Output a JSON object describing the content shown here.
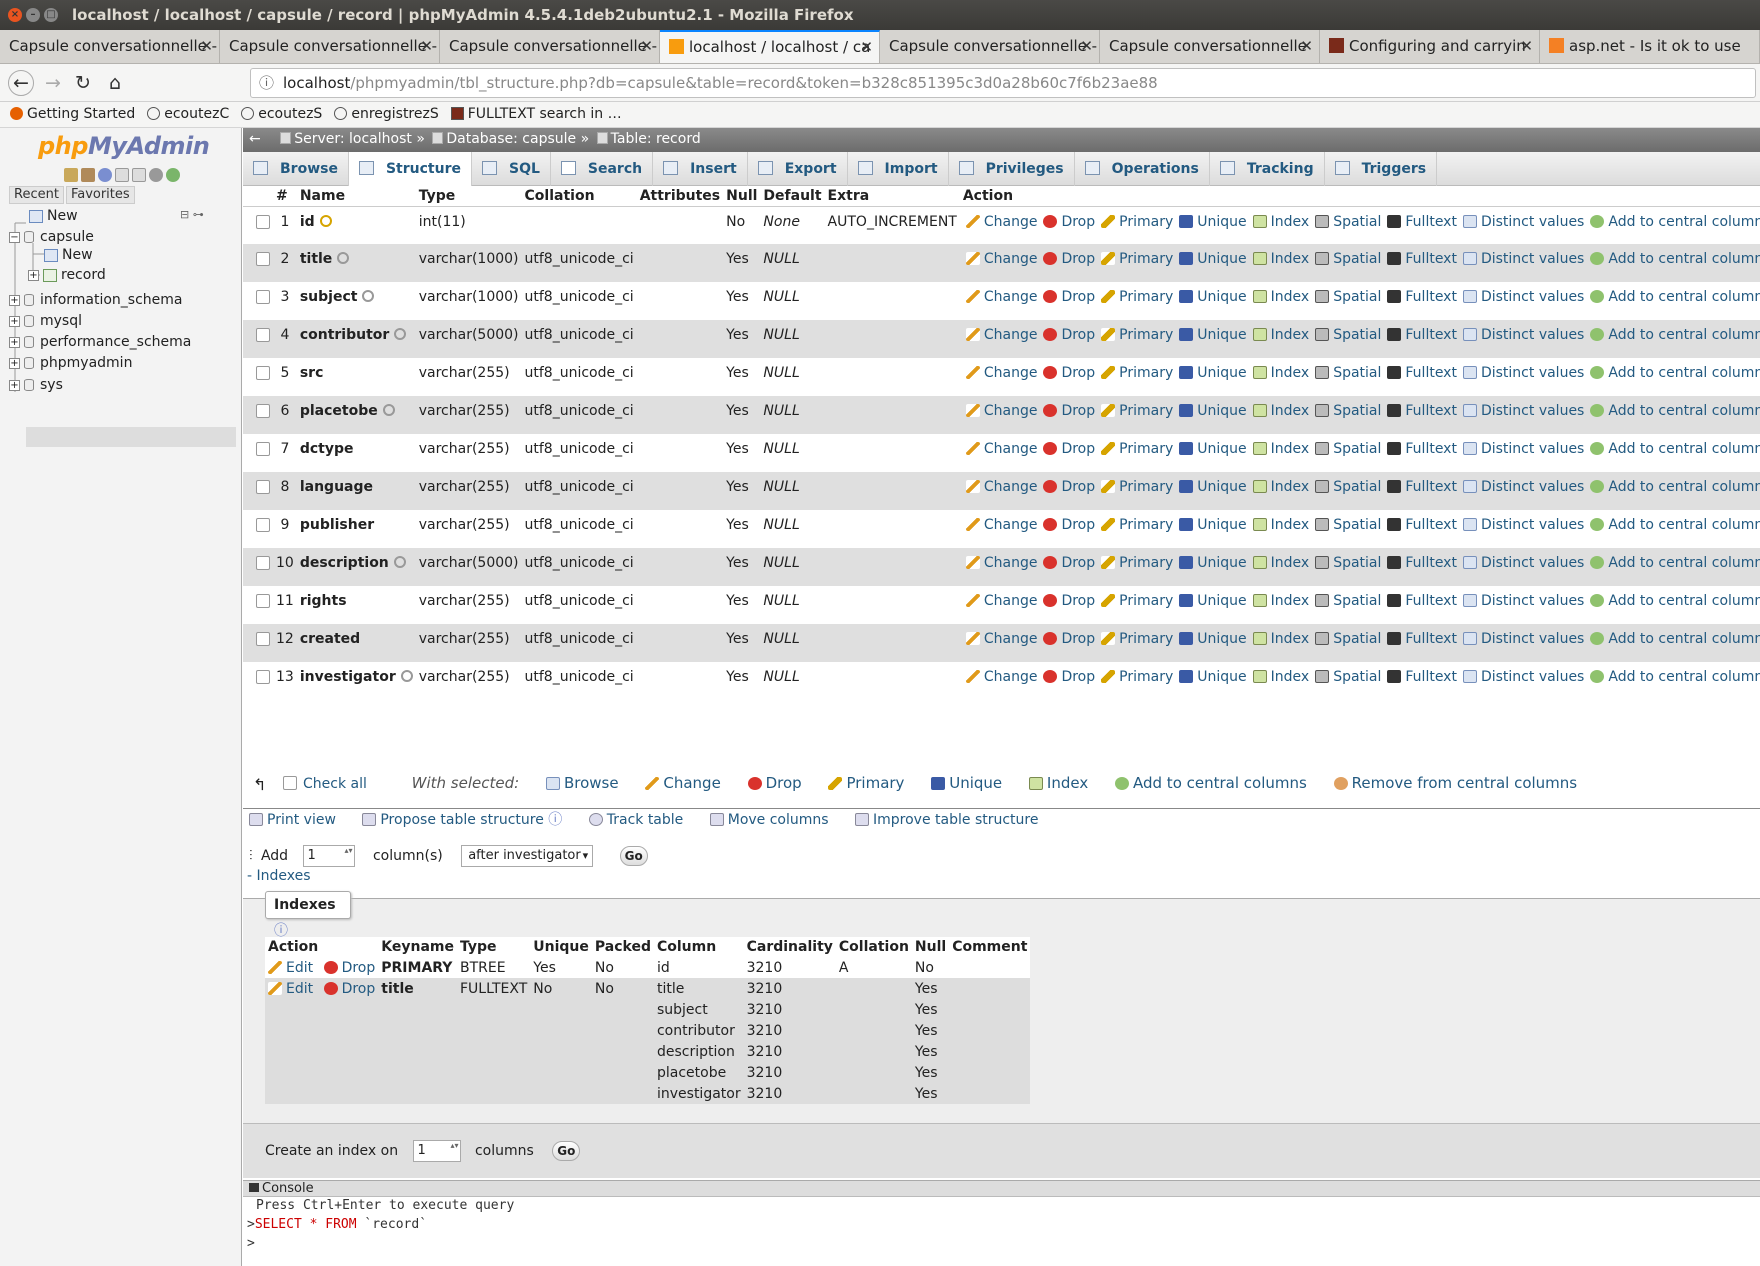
{
  "window": {
    "title": "localhost / localhost / capsule / record | phpMyAdmin 4.5.4.1deb2ubuntu2.1 - Mozilla Firefox"
  },
  "browser_tabs": [
    {
      "label": "Capsule conversationnelle -"
    },
    {
      "label": "Capsule conversationnelle -"
    },
    {
      "label": "Capsule conversationnelle -"
    },
    {
      "label": "localhost / localhost / ca"
    },
    {
      "label": "Capsule conversationnelle -"
    },
    {
      "label": "Capsule conversationnelle"
    },
    {
      "label": "Configuring and carryin"
    },
    {
      "label": "asp.net - Is it ok to use"
    }
  ],
  "url": {
    "host": "localhost",
    "path": "/phpmyadmin/tbl_structure.php?db=capsule&table=record&token=b328c851395c3d0a28b60c7f6b23ae88"
  },
  "bookmarks": [
    "Getting Started",
    "ecoutezC",
    "ecoutezS",
    "enregistrezS",
    "FULLTEXT search in …"
  ],
  "sidebar": {
    "logo_a": "php",
    "logo_b": "MyAdmin",
    "recent": "Recent",
    "favorites": "Favorites",
    "tree": {
      "new": "New",
      "capsule": "capsule",
      "capsule_new": "New",
      "record": "record",
      "information_schema": "information_schema",
      "mysql": "mysql",
      "performance_schema": "performance_schema",
      "phpmyadmin": "phpmyadmin",
      "sys": "sys"
    }
  },
  "breadcrumb": {
    "server": "Server: localhost",
    "database": "Database: capsule",
    "table": "Table: record"
  },
  "tabs": [
    "Browse",
    "Structure",
    "SQL",
    "Search",
    "Insert",
    "Export",
    "Import",
    "Privileges",
    "Operations",
    "Tracking",
    "Triggers"
  ],
  "structure": {
    "headers": [
      "#",
      "Name",
      "Type",
      "Collation",
      "Attributes",
      "Null",
      "Default",
      "Extra",
      "Action"
    ],
    "rows": [
      {
        "n": "1",
        "name": "id",
        "type": "int(11)",
        "collation": "",
        "null": "No",
        "default": "None",
        "extra": "AUTO_INCREMENT"
      },
      {
        "n": "2",
        "name": "title",
        "type": "varchar(1000)",
        "collation": "utf8_unicode_ci",
        "null": "Yes",
        "default": "NULL",
        "extra": ""
      },
      {
        "n": "3",
        "name": "subject",
        "type": "varchar(1000)",
        "collation": "utf8_unicode_ci",
        "null": "Yes",
        "default": "NULL",
        "extra": ""
      },
      {
        "n": "4",
        "name": "contributor",
        "type": "varchar(5000)",
        "collation": "utf8_unicode_ci",
        "null": "Yes",
        "default": "NULL",
        "extra": ""
      },
      {
        "n": "5",
        "name": "src",
        "type": "varchar(255)",
        "collation": "utf8_unicode_ci",
        "null": "Yes",
        "default": "NULL",
        "extra": ""
      },
      {
        "n": "6",
        "name": "placetobe",
        "type": "varchar(255)",
        "collation": "utf8_unicode_ci",
        "null": "Yes",
        "default": "NULL",
        "extra": ""
      },
      {
        "n": "7",
        "name": "dctype",
        "type": "varchar(255)",
        "collation": "utf8_unicode_ci",
        "null": "Yes",
        "default": "NULL",
        "extra": ""
      },
      {
        "n": "8",
        "name": "language",
        "type": "varchar(255)",
        "collation": "utf8_unicode_ci",
        "null": "Yes",
        "default": "NULL",
        "extra": ""
      },
      {
        "n": "9",
        "name": "publisher",
        "type": "varchar(255)",
        "collation": "utf8_unicode_ci",
        "null": "Yes",
        "default": "NULL",
        "extra": ""
      },
      {
        "n": "10",
        "name": "description",
        "type": "varchar(5000)",
        "collation": "utf8_unicode_ci",
        "null": "Yes",
        "default": "NULL",
        "extra": ""
      },
      {
        "n": "11",
        "name": "rights",
        "type": "varchar(255)",
        "collation": "utf8_unicode_ci",
        "null": "Yes",
        "default": "NULL",
        "extra": ""
      },
      {
        "n": "12",
        "name": "created",
        "type": "varchar(255)",
        "collation": "utf8_unicode_ci",
        "null": "Yes",
        "default": "NULL",
        "extra": ""
      },
      {
        "n": "13",
        "name": "investigator",
        "type": "varchar(255)",
        "collation": "utf8_unicode_ci",
        "null": "Yes",
        "default": "NULL",
        "extra": ""
      }
    ],
    "actions": {
      "change": "Change",
      "drop": "Drop",
      "primary": "Primary",
      "unique": "Unique",
      "index": "Index",
      "spatial": "Spatial",
      "fulltext": "Fulltext",
      "distinct": "Distinct values",
      "central": "Add to central columns"
    }
  },
  "bulk": {
    "check_all": "Check all",
    "with_selected": "With selected:",
    "browse": "Browse",
    "change": "Change",
    "drop": "Drop",
    "primary": "Primary",
    "unique": "Unique",
    "index": "Index",
    "add_central": "Add to central columns",
    "remove_central": "Remove from central columns"
  },
  "tools": {
    "print": "Print view",
    "propose": "Propose table structure",
    "track": "Track table",
    "move": "Move columns",
    "improve": "Improve table structure"
  },
  "add_columns": {
    "label": "Add",
    "value": "1",
    "suffix": "column(s)",
    "position": "after investigator",
    "go": "Go"
  },
  "indexes_link": "- Indexes",
  "indexes": {
    "legend": "Indexes",
    "headers": [
      "Action",
      "Keyname",
      "Type",
      "Unique",
      "Packed",
      "Column",
      "Cardinality",
      "Collation",
      "Null",
      "Comment"
    ],
    "edit": "Edit",
    "drop": "Drop",
    "primary": {
      "keyname": "PRIMARY",
      "type": "BTREE",
      "unique": "Yes",
      "packed": "No",
      "column": "id",
      "cardinality": "3210",
      "collation": "A",
      "null": "No"
    },
    "title": {
      "keyname": "title",
      "type": "FULLTEXT",
      "unique": "No",
      "packed": "No",
      "columns": [
        {
          "column": "title",
          "cardinality": "3210",
          "null": "Yes"
        },
        {
          "column": "subject",
          "cardinality": "3210",
          "null": "Yes"
        },
        {
          "column": "contributor",
          "cardinality": "3210",
          "null": "Yes"
        },
        {
          "column": "description",
          "cardinality": "3210",
          "null": "Yes"
        },
        {
          "column": "placetobe",
          "cardinality": "3210",
          "null": "Yes"
        },
        {
          "column": "investigator",
          "cardinality": "3210",
          "null": "Yes"
        }
      ]
    }
  },
  "create_index": {
    "label": "Create an index on",
    "value": "1",
    "suffix": "columns",
    "go": "Go"
  },
  "console": {
    "title": "Console",
    "hint": "Press Ctrl+Enter to execute query",
    "query_kw": "SELECT * FROM",
    "query_rest": " `record`",
    "prompt": ">"
  }
}
